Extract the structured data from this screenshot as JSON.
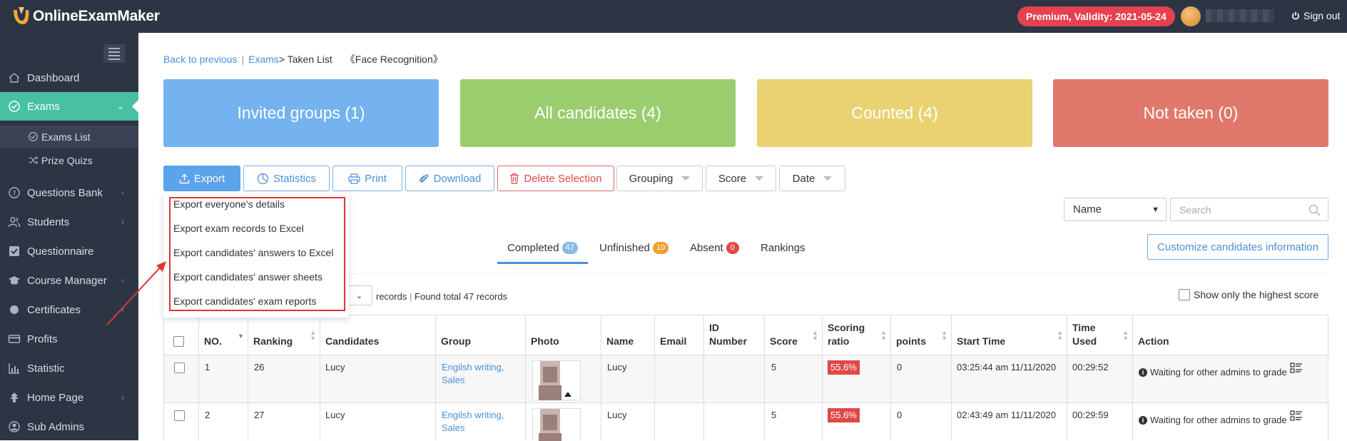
{
  "header": {
    "brand": "OnlineExamMaker",
    "premium_label": "Premium, Validity: 2021-05-24",
    "sign_out": "Sign out"
  },
  "sidebar": {
    "items": [
      {
        "label": "Dashboard",
        "icon": "home-icon"
      },
      {
        "label": "Exams",
        "icon": "check-circle-icon",
        "active": true
      },
      {
        "label": "Questions Bank",
        "icon": "question-circle-icon"
      },
      {
        "label": "Students",
        "icon": "users-icon"
      },
      {
        "label": "Questionnaire",
        "icon": "checkbox-icon"
      },
      {
        "label": "Course Manager",
        "icon": "graduation-cap-icon"
      },
      {
        "label": "Certificates",
        "icon": "certificate-icon"
      },
      {
        "label": "Profits",
        "icon": "credit-card-icon"
      },
      {
        "label": "Statistic",
        "icon": "bar-chart-icon"
      },
      {
        "label": "Home Page",
        "icon": "home-page-icon"
      },
      {
        "label": "Sub Admins",
        "icon": "sub-admin-icon"
      }
    ],
    "sub_items": [
      {
        "label": "Exams List",
        "icon": "check-circle-icon"
      },
      {
        "label": "Prize Quizs",
        "icon": "shuffle-icon"
      }
    ]
  },
  "breadcrumb": {
    "back": "Back to previous",
    "separator": "|",
    "exams": "Exams",
    "current": "> Taken List",
    "exam_name": "《Face Recognition》"
  },
  "cards": [
    {
      "label": "Invited groups (1)",
      "color": "#74b3ef"
    },
    {
      "label": "All candidates (4)",
      "color": "#9acd6e"
    },
    {
      "label": "Counted (4)",
      "color": "#ead273"
    },
    {
      "label": "Not taken (0)",
      "color": "#e0796b"
    }
  ],
  "toolbar": {
    "export": "Export",
    "statistics": "Statistics",
    "print": "Print",
    "download": "Download",
    "delete_selection": "Delete Selection",
    "grouping": "Grouping",
    "score": "Score",
    "date": "Date"
  },
  "export_menu": [
    "Export everyone's details",
    "Export exam records to Excel",
    "Export candidates' answers to Excel",
    "Export candidates' answer sheets",
    "Export candidates' exam reports"
  ],
  "filter": {
    "field_select": "Name",
    "search_placeholder": "Search"
  },
  "tabs": [
    {
      "label": "Completed",
      "count": "47",
      "color": "#8ab8e8"
    },
    {
      "label": "Unfinished",
      "count": "10",
      "color": "#f0a030"
    },
    {
      "label": "Absent",
      "count": "0",
      "color": "#e04848"
    },
    {
      "label": "Rankings",
      "count": null
    }
  ],
  "customize_button": "Customize candidates information",
  "records": {
    "label": "records",
    "found": "Found total 47 records",
    "highest_only": "Show only the highest score"
  },
  "table": {
    "columns": [
      "NO.",
      "Ranking",
      "Candidates",
      "Group",
      "Photo",
      "Name",
      "Email",
      "ID Number",
      "Score",
      "Scoring ratio",
      "points",
      "Start Time",
      "Time Used",
      "Action"
    ],
    "rows": [
      {
        "no": "1",
        "ranking": "26",
        "candidate": "Lucy",
        "group": "Engilsh writing, Sales",
        "name": "Lucy",
        "email": "",
        "id_number": "",
        "score": "5",
        "ratio": "55.6%",
        "points": "0",
        "start": "03:25:44 am 11/11/2020",
        "used": "00:29:52",
        "action": "Waiting for other admins to grade"
      },
      {
        "no": "2",
        "ranking": "27",
        "candidate": "Lucy",
        "group": "Engilsh writing, Sales",
        "name": "Lucy",
        "email": "",
        "id_number": "",
        "score": "5",
        "ratio": "55.6%",
        "points": "0",
        "start": "02:43:49 am 11/11/2020",
        "used": "00:29:59",
        "action": "Waiting for other admins to grade"
      }
    ]
  }
}
